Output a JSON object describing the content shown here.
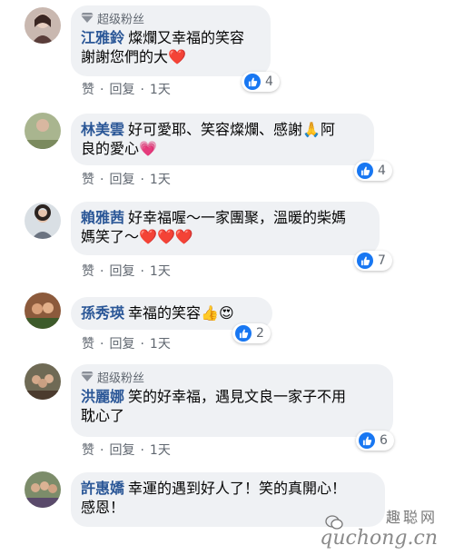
{
  "badge_text": "超级粉丝",
  "action_like": "赞",
  "action_reply": "回复",
  "separator": "·",
  "comments": [
    {
      "name": "江雅鈴",
      "has_badge": true,
      "line1": "燦爛又幸福的笑容",
      "line2": "謝謝您們的大",
      "line2_emoji": "❤️",
      "reactions": "4",
      "time": "1天"
    },
    {
      "name": "林美雲",
      "has_badge": false,
      "line1": "好可愛耶、笑容燦爛、感謝🙏阿",
      "line2": "良的愛心💗",
      "reactions": "4",
      "time": "1天"
    },
    {
      "name": "賴雅茜",
      "has_badge": false,
      "line1": "好幸福喔～一家團聚，溫暖的柴媽",
      "line2": "媽笑了～",
      "line2_emoji": "❤️❤️❤️",
      "reactions": "7",
      "time": "1天"
    },
    {
      "name": "孫秀瑛",
      "has_badge": false,
      "line1": "幸福的笑容👍😍",
      "reactions": "2",
      "time": "1天"
    },
    {
      "name": "洪麗娜",
      "has_badge": true,
      "line1": "笑的好幸福，遇見文良一家子不用",
      "line2": "耽心了",
      "reactions": "6",
      "time": "1天"
    },
    {
      "name": "許惠嬌",
      "has_badge": false,
      "line1": "幸運的遇到好人了！笑的真開心！",
      "line2": "感恩！"
    }
  ],
  "watermark": {
    "top": "趣聪网",
    "bottom": "quchong.cn"
  },
  "colors": {
    "bubble": "#eff1f4",
    "name": "#2b5797",
    "like": "#1877f2",
    "meta": "#606770",
    "heart": "#e0202a"
  }
}
